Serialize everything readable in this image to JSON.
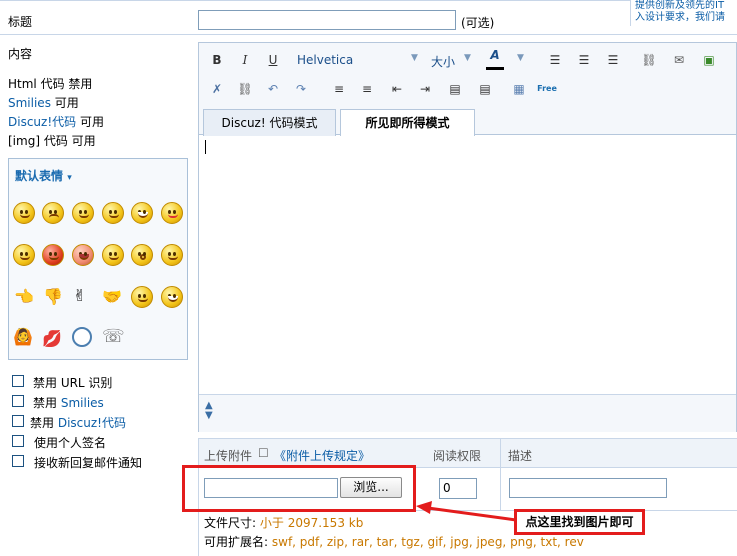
{
  "left": {
    "title_label": "标题",
    "content_label": "内容",
    "html_line": "Html 代码 禁用",
    "smilies_line": {
      "name": "Smilies",
      "state": "可用"
    },
    "discuz_line": {
      "name": "Discuz!代码",
      "state": "可用"
    },
    "img_line": "[img] 代码 可用",
    "smiley_panel_title": "默认表情",
    "options": [
      {
        "text": "禁用  URL 识别",
        "link": ""
      },
      {
        "text": "禁用",
        "link": "Smilies"
      },
      {
        "text": "禁用",
        "link": "Discuz!代码"
      },
      {
        "text": "使用个人签名",
        "link": ""
      },
      {
        "text": "接收新回复邮件通知",
        "link": ""
      }
    ]
  },
  "header": {
    "title_optional": "(可选)",
    "hint_text": "提供创新及领先的IT\n入设计要求，我们请"
  },
  "toolbar": {
    "font_name": "Helvetica",
    "font_size": "大小",
    "bold": "B",
    "italic": "I",
    "underline": "U"
  },
  "tabs": {
    "code_mode": "Discuz! 代码模式",
    "wysiwyg_mode": "所见即所得模式"
  },
  "attachments": {
    "upload_label": "上传附件",
    "rules_link": "《附件上传规定》",
    "perm_label": "阅读权限",
    "desc_label": "描述",
    "browse_button": "浏览...",
    "perm_value": "0",
    "size_label": "文件尺寸:",
    "size_value": "小于 2097.153 kb",
    "ext_label": "可用扩展名:",
    "ext_value": "swf, pdf, zip, rar, tar, tgz, gif, jpg, jpeg, png, txt, rev"
  },
  "annotation": {
    "callout_text": "点这里找到图片即可"
  },
  "colors": {
    "link_blue": "#0b5da6",
    "annotation_red": "#e31c1c",
    "orange_text": "#c87800"
  }
}
